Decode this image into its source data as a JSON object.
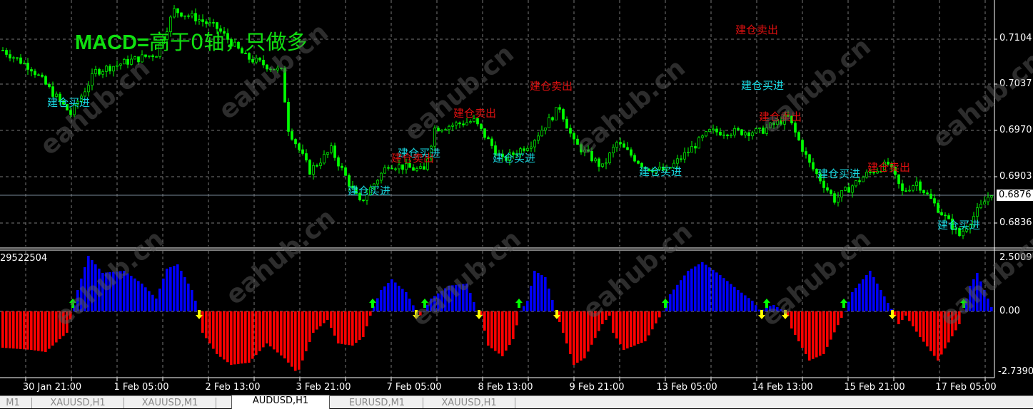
{
  "chart_title_prefix": "MACD=",
  "chart_title_rest": "高于0轴，只做多",
  "indicator_label": "29522504",
  "watermark": "eahub.cn",
  "price_axis": [
    "0.7104",
    "0.7037",
    "0.6970",
    "0.6903",
    "0.6836"
  ],
  "current_price": "0.6876",
  "macd_axis": [
    "2.50091",
    "0.00",
    "-2.7390"
  ],
  "time_axis": [
    "30 Jan 21:00",
    "1 Feb 05:00",
    "2 Feb 13:00",
    "3 Feb 21:00",
    "7 Feb 05:00",
    "8 Feb 13:00",
    "9 Feb 21:00",
    "13 Feb 05:00",
    "14 Feb 13:00",
    "15 Feb 21:00",
    "17 Feb 05:00"
  ],
  "signals": {
    "buy_label": "建仓买进",
    "sell_label": "建仓卖出"
  },
  "tabs": [
    {
      "label": "M1",
      "active": false
    },
    {
      "label": "XAUUSD,H1",
      "active": false
    },
    {
      "label": "XAUUSD,M1",
      "active": false
    },
    {
      "label": "AUDUSD,H1",
      "active": true
    },
    {
      "label": "EURUSD,M1",
      "active": false
    },
    {
      "label": "XAUUSD,H1",
      "active": false
    }
  ],
  "colors": {
    "candle": "#00ff00",
    "hist_pos": "#0000ff",
    "hist_neg": "#ff0000",
    "arrow_up": "#00ff00",
    "arrow_down": "#ffff00",
    "buy": "#19d7e0",
    "sell": "#e01010"
  },
  "chart_data": {
    "type": "line",
    "symbol": "AUDUSD,H1",
    "price_path": {
      "bar": [
        0,
        8,
        19,
        26,
        36,
        43,
        48,
        54,
        60,
        68,
        78,
        80,
        86,
        92,
        100,
        108,
        118,
        121,
        132,
        140,
        148,
        156,
        160,
        168,
        172,
        180,
        186,
        198,
        212,
        220,
        226,
        233,
        242,
        248,
        252,
        256,
        268,
        277
      ],
      "price": [
        0.7088,
        0.7062,
        0.6995,
        0.7057,
        0.7073,
        0.7083,
        0.7146,
        0.7135,
        0.712,
        0.7078,
        0.7057,
        0.6974,
        0.6912,
        0.6943,
        0.6865,
        0.6922,
        0.6912,
        0.6974,
        0.6985,
        0.6927,
        0.6953,
        0.7005,
        0.6953,
        0.6917,
        0.6953,
        0.6917,
        0.6912,
        0.6969,
        0.6969,
        0.699,
        0.6922,
        0.687,
        0.6907,
        0.6922,
        0.6881,
        0.6896,
        0.6818,
        0.6881
      ]
    },
    "macd": {
      "bar": [
        0,
        8,
        12,
        18,
        19.6,
        21,
        24,
        28,
        34,
        39,
        43,
        46,
        49,
        53,
        55,
        56,
        60,
        64,
        69,
        74,
        79,
        82.6,
        87,
        91,
        94,
        98,
        101,
        103.4,
        106,
        109,
        113,
        115.6,
        116.4,
        118,
        120,
        125,
        130,
        133,
        134,
        136,
        140,
        143,
        145,
        147,
        149,
        152,
        155,
        156,
        160,
        163,
        168,
        170,
        171,
        174,
        180,
        185,
        187,
        192,
        196,
        201,
        206,
        210,
        212.4,
        214,
        216,
        218,
        219.6,
        221,
        226,
        230,
        235,
        236,
        238,
        243,
        248,
        249.4,
        251,
        253,
        257,
        262,
        268,
        269,
        271,
        273,
        277
      ],
      "value": [
        -1.7,
        -1.8,
        -1.9,
        -1.0,
        0,
        1.0,
        2.6,
        1.8,
        1.9,
        1.3,
        0.6,
        2.0,
        2.2,
        1.0,
        0,
        -1.0,
        -2.0,
        -2.5,
        -2.4,
        -1.5,
        -2.2,
        -2.9,
        -1.0,
        -0.4,
        -1.5,
        -1.6,
        -1.2,
        0,
        1.0,
        1.5,
        0.9,
        0.1,
        -0.3,
        0,
        0.6,
        1.2,
        1.3,
        0,
        -0.2,
        -1.6,
        -2.1,
        -1.3,
        0,
        0.5,
        1.9,
        1.6,
        0,
        -0.5,
        -2.5,
        -2.2,
        -0.6,
        -0.2,
        -1.0,
        -1.8,
        -1.4,
        0,
        0.8,
        1.9,
        2.3,
        1.7,
        1.0,
        0.5,
        0,
        0.2,
        0.3,
        0.1,
        0,
        -0.8,
        -2.3,
        -2.0,
        -0.3,
        0,
        0.9,
        1.9,
        0.4,
        0,
        -0.6,
        -0.2,
        -1.2,
        -2.3,
        -0.6,
        0,
        1.2,
        1.8,
        0.2
      ]
    },
    "buy_arrows_bar": [
      20,
      104,
      118.6,
      145,
      186,
      214.4,
      236,
      269.6
    ],
    "sell_arrows_bar": [
      55.4,
      116.2,
      133.8,
      155.6,
      213,
      219.6,
      249.6
    ],
    "ylim_price": [
      0.68,
      0.716
    ],
    "ylim_macd": [
      -2.739,
      2.50091
    ]
  }
}
